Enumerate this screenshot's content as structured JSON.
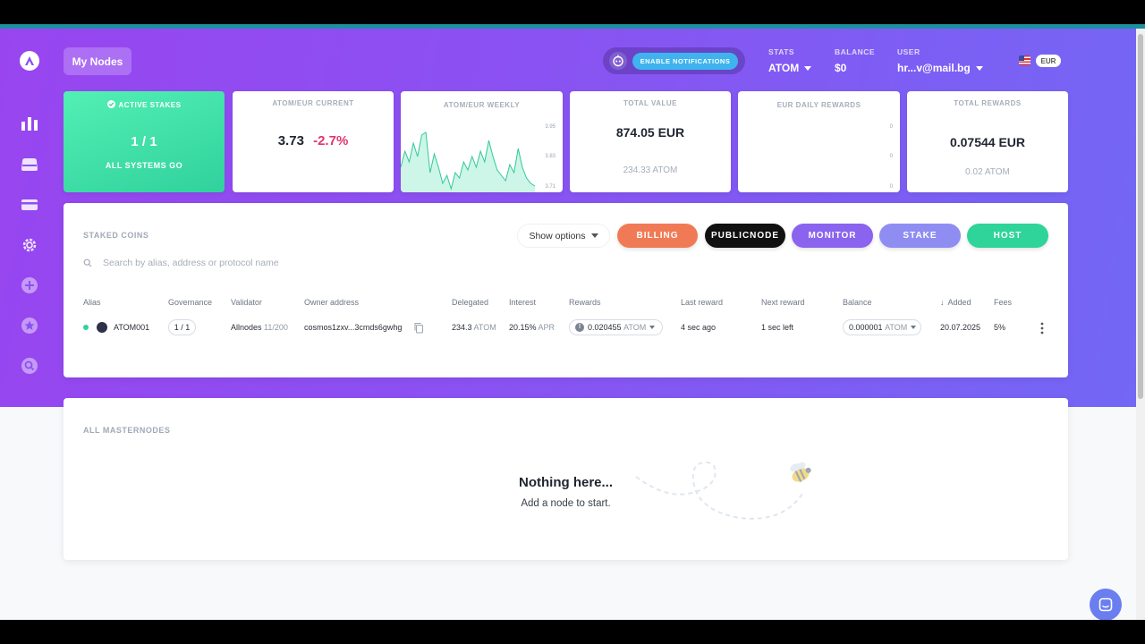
{
  "header": {
    "my_nodes": "My Nodes",
    "enable_notifications": "ENABLE NOTIFICATIONS",
    "stats_label": "STATS",
    "stats_value": "ATOM",
    "balance_label": "BALANCE",
    "balance_value": "$0",
    "user_label": "USER",
    "user_value": "hr...v@mail.bg",
    "currency": "EUR"
  },
  "cards": {
    "active": {
      "title": "ACTIVE STAKES",
      "value": "1 / 1",
      "subtitle": "ALL SYSTEMS GO"
    },
    "current": {
      "title": "ATOM/EUR CURRENT",
      "price": "3.73",
      "change": "-2.7%"
    },
    "weekly": {
      "title": "ATOM/EUR WEEKLY",
      "ticks": [
        "3.95",
        "3.83",
        "3.71"
      ]
    },
    "total_value": {
      "title": "TOTAL VALUE",
      "value": "874.05 EUR",
      "sub": "234.33 ATOM"
    },
    "daily": {
      "title": "EUR DAILY REWARDS",
      "ticks": [
        "0",
        "0",
        "0"
      ]
    },
    "total_rewards": {
      "title": "TOTAL REWARDS",
      "value": "0.07544 EUR",
      "sub": "0.02 ATOM"
    }
  },
  "staked": {
    "title": "STAKED COINS",
    "show_options": "Show options",
    "buttons": {
      "billing": "BILLING",
      "publicnode": "PUBLICNODE",
      "monitor": "MONITOR",
      "stake": "STAKE",
      "host": "HOST"
    },
    "search_placeholder": "Search by alias, address or protocol name",
    "columns": [
      "Alias",
      "Governance",
      "Validator",
      "Owner address",
      "Delegated",
      "Interest",
      "Rewards",
      "Last reward",
      "Next reward",
      "Balance",
      "Added",
      "Fees"
    ],
    "row": {
      "alias": "ATOM001",
      "governance": "1 / 1",
      "validator": "Allnodes",
      "validator_count": "11/200",
      "owner_address": "cosmos1zxv...3cmds6gwhg",
      "delegated": "234.3",
      "delegated_unit": "ATOM",
      "interest": "20.15%",
      "interest_unit": "APR",
      "rewards": "0.020455",
      "rewards_unit": "ATOM",
      "last_reward": "4 sec ago",
      "next_reward": "1 sec left",
      "balance": "0.000001",
      "balance_unit": "ATOM",
      "added": "20.07.2025",
      "fees": "5%"
    }
  },
  "masternodes": {
    "title": "ALL MASTERNODES",
    "empty_title": "Nothing here...",
    "empty_sub": "Add a node to start."
  },
  "colors": {
    "billing": "#f07a56",
    "publicnode": "#111111",
    "monitor": "#8a63ee",
    "stake": "#8f8df2",
    "host": "#2ed49a",
    "negative": "#e0366f"
  },
  "weekly_series": [
    3.8,
    3.86,
    3.82,
    3.89,
    3.84,
    3.92,
    3.93,
    3.78,
    3.85,
    3.8,
    3.74,
    3.77,
    3.72,
    3.78,
    3.76,
    3.82,
    3.79,
    3.84,
    3.8,
    3.86,
    3.82,
    3.9,
    3.84,
    3.79,
    3.77,
    3.75,
    3.81,
    3.78,
    3.87,
    3.8,
    3.76,
    3.74,
    3.73
  ]
}
